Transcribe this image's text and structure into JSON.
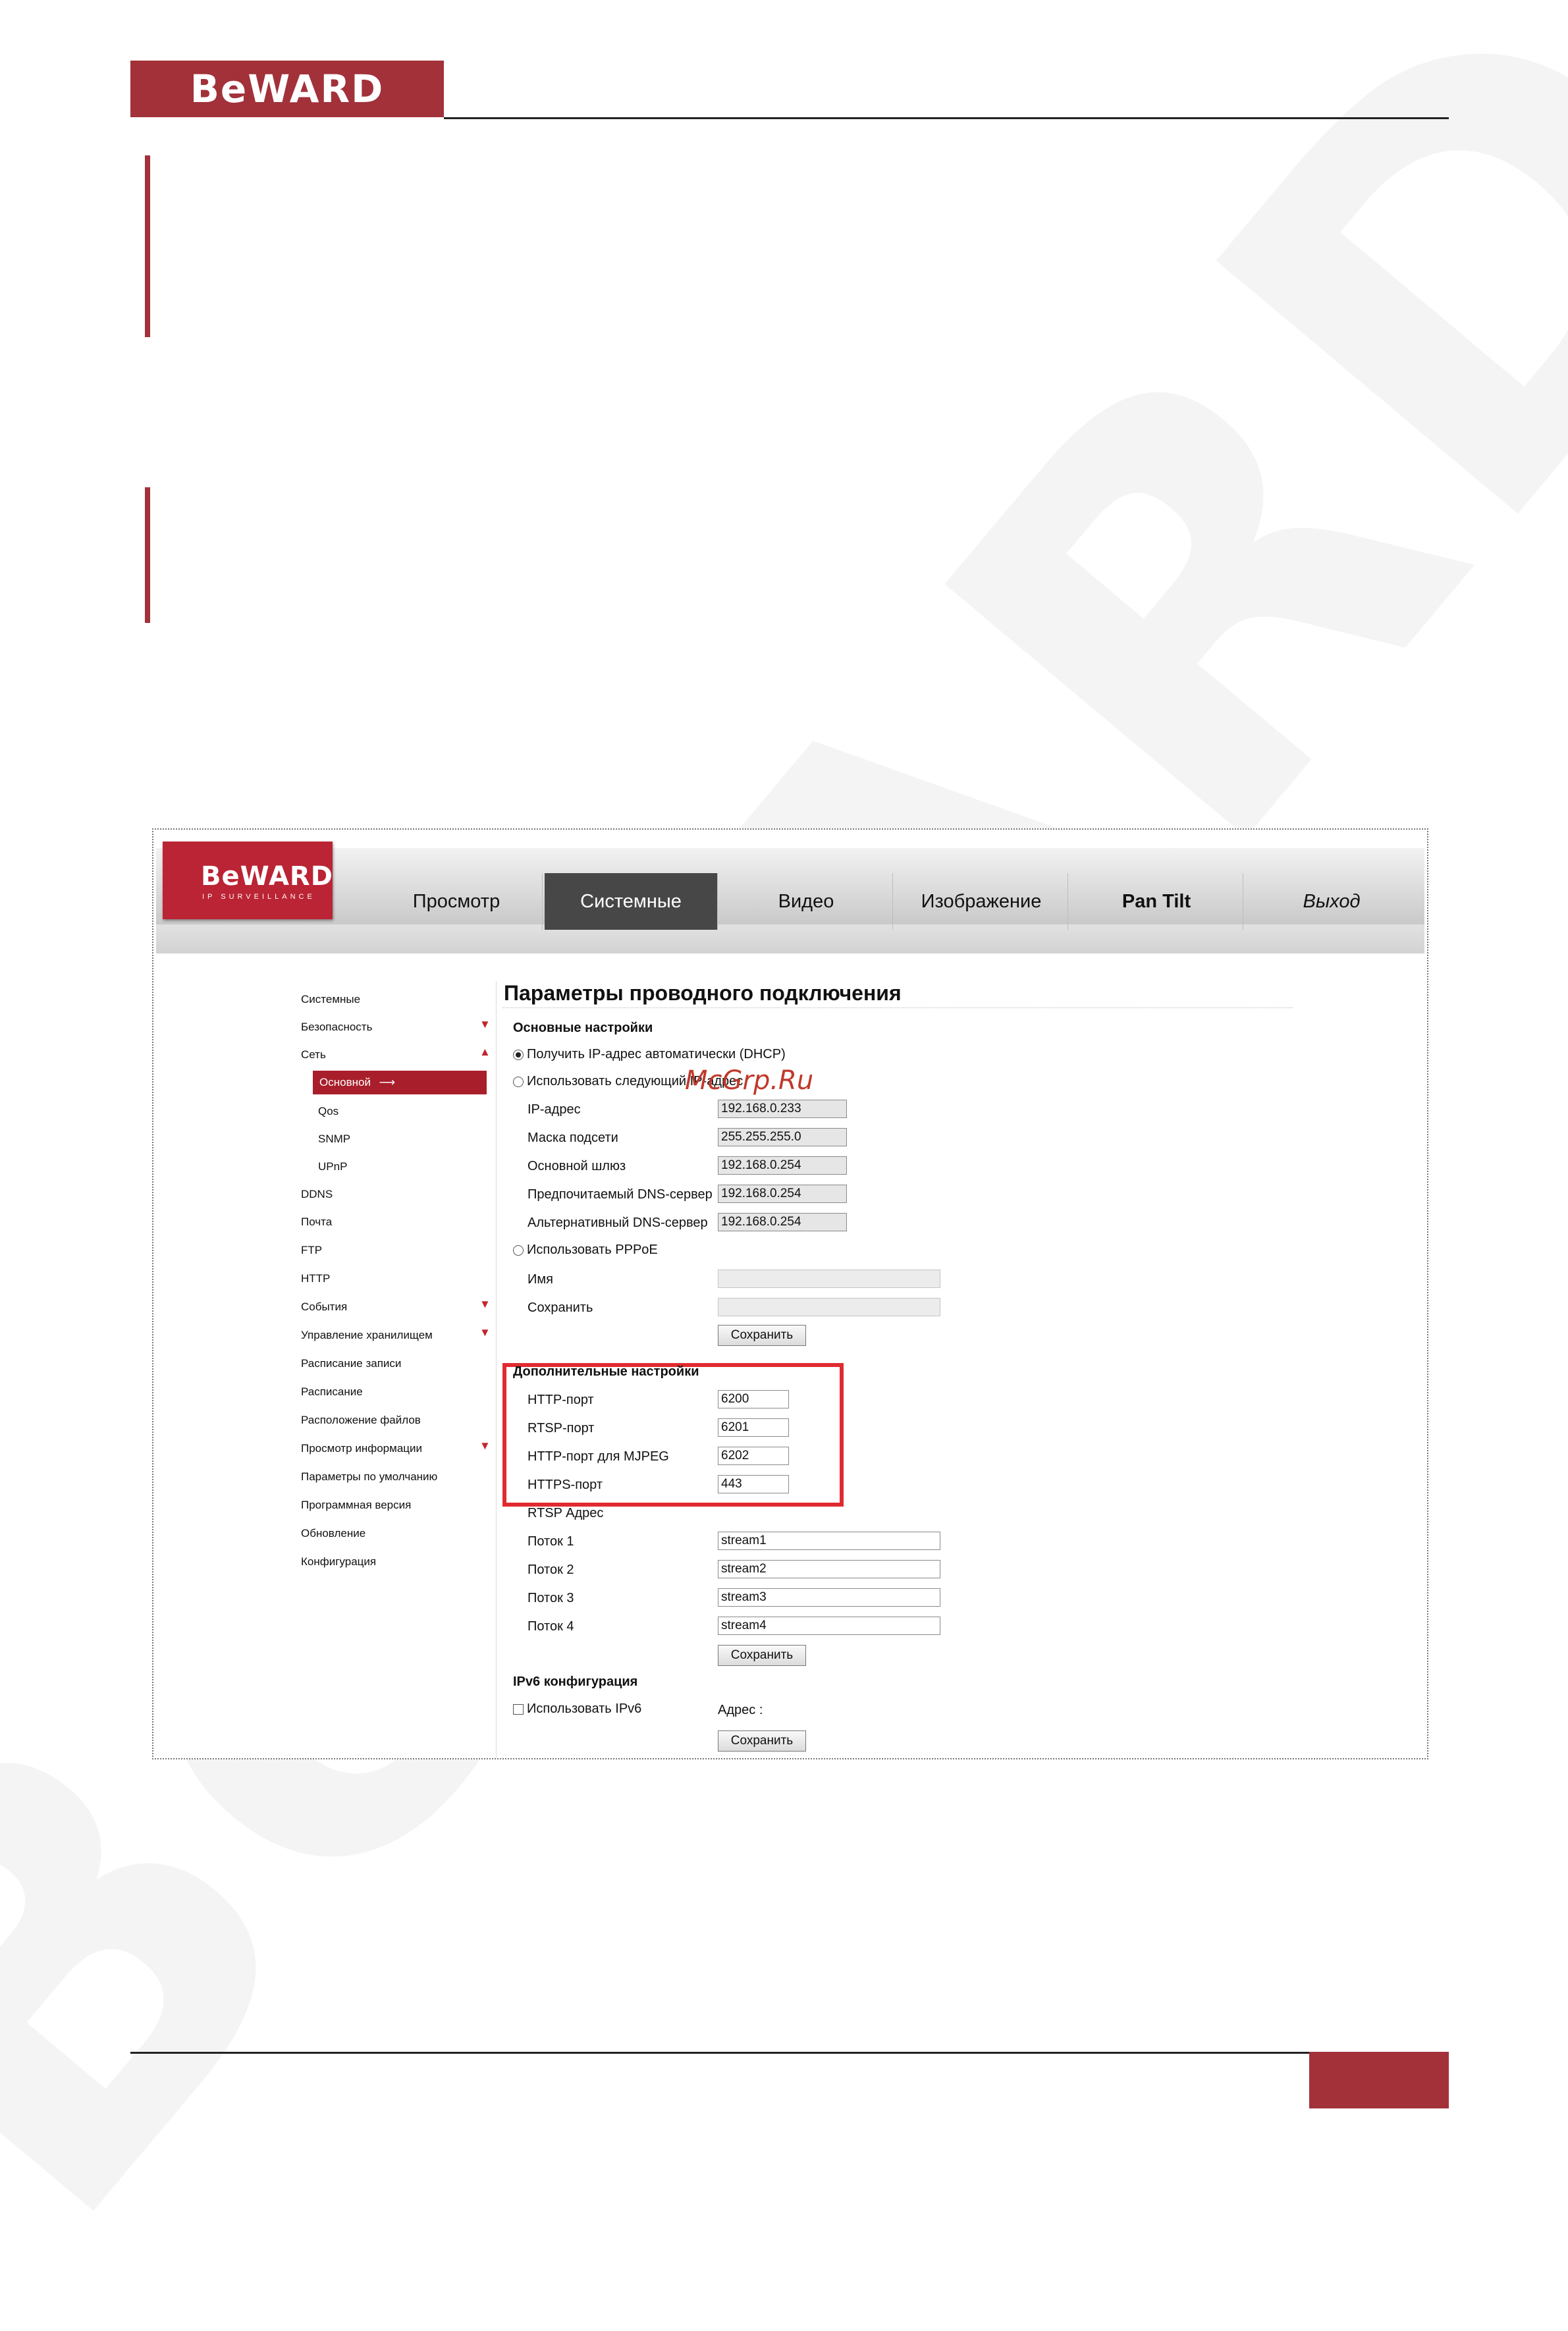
{
  "page_header": {
    "logo": "BeWARD"
  },
  "watermark": {
    "text": "BeWARD",
    "site": "McGrp.Ru"
  },
  "camera_ui": {
    "logo": "BeWARD",
    "logo_sub": "IP SURVEILLANCE",
    "tabs": [
      "Просмотр",
      "Системные",
      "Видео",
      "Изображение",
      "Pan Tilt",
      "Выход"
    ],
    "sidebar": [
      "Системные",
      "Безопасность",
      "Сеть",
      "Основной",
      "Qos",
      "SNMP",
      "UPnP",
      "DDNS",
      "Почта",
      "FTP",
      "HTTP",
      "События",
      "Управление хранилищем",
      "Расписание записи",
      "Расписание",
      "Расположение файлов",
      "Просмотр информации",
      "Параметры по умолчанию",
      "Программная версия",
      "Обновление",
      "Конфигурация"
    ],
    "selected_arrow": "⟶",
    "title": "Параметры проводного подключения",
    "basic": {
      "heading": "Основные настройки",
      "dhcp": "Получить IP-адрес автоматически (DHCP)",
      "static": "Использовать следующий IP-адрес",
      "ip_label": "IP-адрес",
      "ip": "192.168.0.233",
      "mask_label": "Маска подсети",
      "mask": "255.255.255.0",
      "gw_label": "Основной шлюз",
      "gw": "192.168.0.254",
      "dns1_label": "Предпочитаемый DNS-сервер",
      "dns1": "192.168.0.254",
      "dns2_label": "Альтернативный DNS-сервер",
      "dns2": "192.168.0.254",
      "pppoe": "Использовать PPPoE",
      "name_label": "Имя",
      "save_label": "Сохранить",
      "button": "Сохранить"
    },
    "advanced": {
      "heading": "Дополнительные настройки",
      "http_label": "HTTP-порт",
      "http": "6200",
      "rtsp_label": "RTSP-порт",
      "rtsp": "6201",
      "mjpeg_label": "HTTP-порт для MJPEG",
      "mjpeg": "6202",
      "https_label": "HTTPS-порт",
      "https": "443",
      "rtsp_addr_label": "RTSP Адрес",
      "stream1_label": "Поток 1",
      "stream1": "stream1",
      "stream2_label": "Поток 2",
      "stream2": "stream2",
      "stream3_label": "Поток 3",
      "stream3": "stream3",
      "stream4_label": "Поток 4",
      "stream4": "stream4",
      "button": "Сохранить"
    },
    "ipv6": {
      "heading": "IPv6 конфигурация",
      "use": "Использовать IPv6",
      "addr_label": "Адрес :",
      "button": "Сохранить"
    }
  }
}
